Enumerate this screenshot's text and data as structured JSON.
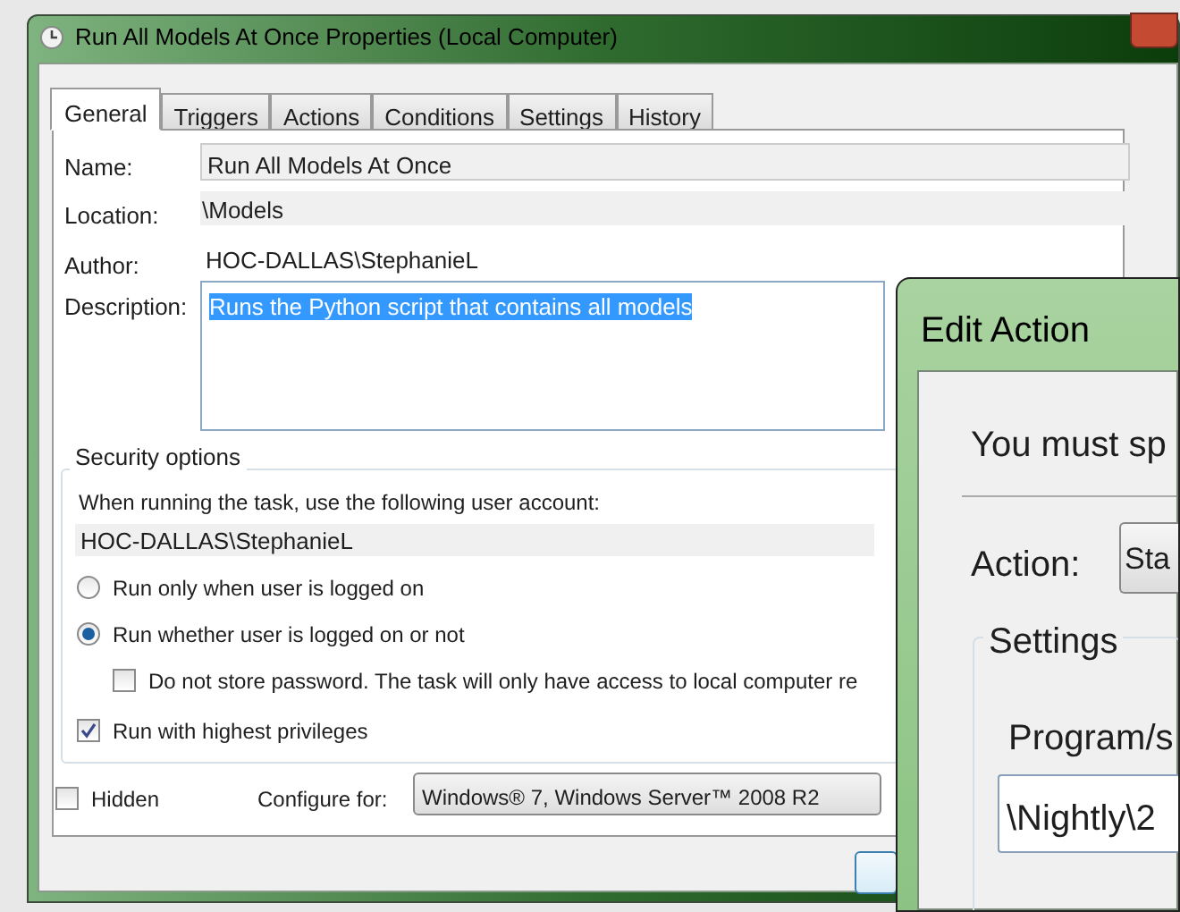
{
  "window": {
    "title": "Run All Models At Once Properties (Local Computer)"
  },
  "tabs": [
    {
      "label": "General",
      "selected": true
    },
    {
      "label": "Triggers",
      "selected": false
    },
    {
      "label": "Actions",
      "selected": false
    },
    {
      "label": "Conditions",
      "selected": false
    },
    {
      "label": "Settings",
      "selected": false
    },
    {
      "label": "History",
      "selected": false
    }
  ],
  "fields": [
    {
      "label": "Name:",
      "value": "Run All Models At Once",
      "kind": "input"
    },
    {
      "label": "Location:",
      "value": "\\Models",
      "kind": "readonly"
    },
    {
      "label": "Author:",
      "value": "HOC-DALLAS\\StephanieL",
      "kind": "plain"
    }
  ],
  "description": {
    "label": "Description:",
    "value": "Runs the Python script that contains all models",
    "selected": true
  },
  "security": {
    "title": "Security options",
    "prompt": "When running the task, use the following user account:",
    "account": "HOC-DALLAS\\StephanieL",
    "options": [
      {
        "kind": "radio",
        "label": "Run only when user is logged on",
        "selected": false
      },
      {
        "kind": "radio",
        "label": "Run whether user is logged on or not",
        "selected": true
      },
      {
        "kind": "checkbox",
        "label": "Do not store password.  The task will only have access to local computer re",
        "checked": false
      },
      {
        "kind": "checkbox",
        "label": "Run with highest privileges",
        "checked": true
      }
    ]
  },
  "hidden": {
    "label": "Hidden",
    "checked": false
  },
  "configure": {
    "label": "Configure for:",
    "value": "Windows® 7, Windows Server™ 2008 R2"
  },
  "edit_action": {
    "title": "Edit Action",
    "message": "You must sp",
    "action_label": "Action:",
    "action_value": "Sta",
    "settings_title": "Settings",
    "program_label": "Program/s",
    "program_value": "\\Nightly\\2"
  }
}
